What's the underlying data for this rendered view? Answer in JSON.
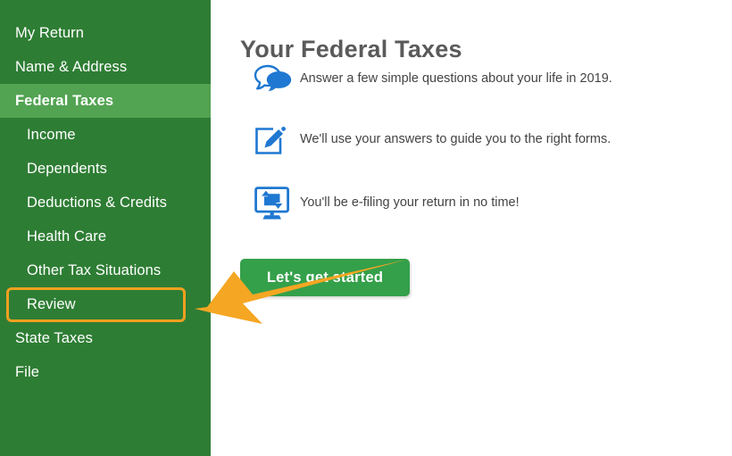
{
  "sidebar": {
    "background_color": "#2e7d34",
    "active_background_color": "#52a352",
    "items": [
      {
        "label": "My Return",
        "level": "top",
        "active": false
      },
      {
        "label": "Name & Address",
        "level": "top",
        "active": false
      },
      {
        "label": "Federal Taxes",
        "level": "top",
        "active": true
      },
      {
        "label": "Income",
        "level": "sub",
        "active": false
      },
      {
        "label": "Dependents",
        "level": "sub",
        "active": false
      },
      {
        "label": "Deductions & Credits",
        "level": "sub",
        "active": false
      },
      {
        "label": "Health Care",
        "level": "sub",
        "active": false
      },
      {
        "label": "Other Tax Situations",
        "level": "sub",
        "active": false
      },
      {
        "label": "Review",
        "level": "sub",
        "active": false
      },
      {
        "label": "State Taxes",
        "level": "top",
        "active": false
      },
      {
        "label": "File",
        "level": "top",
        "active": false
      }
    ]
  },
  "highlight": {
    "target_label": "Review",
    "color": "#f0a020"
  },
  "main": {
    "title": "Your Federal Taxes",
    "features": [
      {
        "icon": "speech-bubbles-icon",
        "text": "Answer a few simple questions about your life in 2019."
      },
      {
        "icon": "edit-pencil-square-icon",
        "text": "We'll use your answers to guide you to the right forms."
      },
      {
        "icon": "monitor-sync-icon",
        "text": "You'll be e-filing your return in no time!"
      }
    ],
    "cta_label": "Let's get started",
    "cta_color": "#34a04a",
    "icon_color": "#1f78d1"
  },
  "annotation": {
    "arrow_color": "#f5a623",
    "points_to": "Review"
  }
}
